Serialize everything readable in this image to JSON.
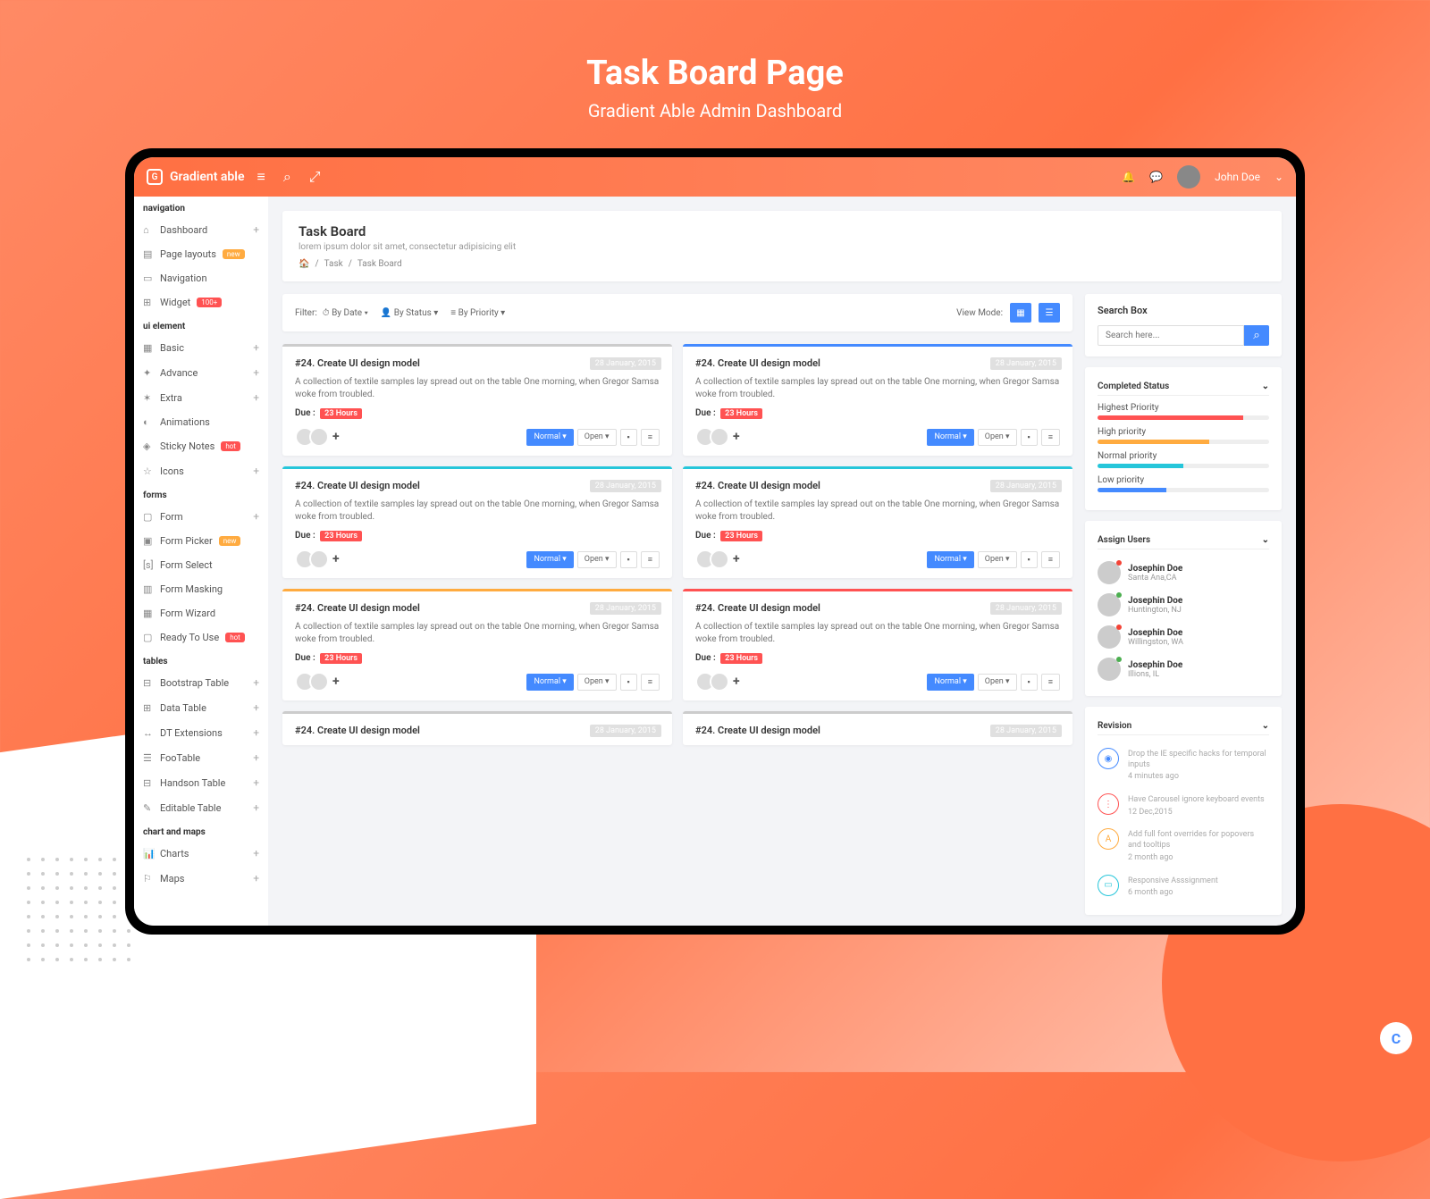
{
  "hero": {
    "title": "Task Board Page",
    "subtitle": "Gradient Able Admin Dashboard"
  },
  "brand": "Gradient able",
  "user": "John Doe",
  "page": {
    "title": "Task Board",
    "subtitle": "lorem ipsum dolor sit amet, consectetur adipisicing elit",
    "crumb1": "Task",
    "crumb2": "Task Board"
  },
  "nav": {
    "s1": "navigation",
    "dashboard": "Dashboard",
    "layouts": "Page layouts",
    "navitem": "Navigation",
    "widget": "Widget",
    "new": "new",
    "hundred": "100+",
    "s2": "ui element",
    "basic": "Basic",
    "advance": "Advance",
    "extra": "Extra",
    "anim": "Animations",
    "sticky": "Sticky Notes",
    "hot": "hot",
    "icons": "Icons",
    "s3": "forms",
    "form": "Form",
    "picker": "Form Picker",
    "select": "Form Select",
    "mask": "Form Masking",
    "wizard": "Form Wizard",
    "ready": "Ready To Use",
    "s4": "tables",
    "bstable": "Bootstrap Table",
    "dtable": "Data Table",
    "dtext": "DT Extensions",
    "foo": "FooTable",
    "handson": "Handson Table",
    "edit": "Editable Table",
    "s5": "chart and maps",
    "charts": "Charts",
    "maps": "Maps"
  },
  "filter": {
    "label": "Filter:",
    "date": "By Date",
    "status": "By Status",
    "priority": "By Priority",
    "viewmode": "View Mode:"
  },
  "task": {
    "title": "#24. Create UI design model",
    "date": "28 January, 2015",
    "desc": "A collection of textile samples lay spread out on the table One morning, when Gregor Samsa woke from troubled.",
    "due": "Due :",
    "duetime": "23 Hours",
    "normal": "Normal",
    "open": "Open"
  },
  "search": {
    "title": "Search Box",
    "placeholder": "Search here..."
  },
  "status": {
    "title": "Completed Status",
    "p1": "Highest Priority",
    "p2": "High priority",
    "p3": "Normal priority",
    "p4": "Low priority"
  },
  "users": {
    "title": "Assign Users",
    "name": "Josephin Doe",
    "l1": "Santa Ana,CA",
    "l2": "Huntington, NJ",
    "l3": "Willingston, WA",
    "l4": "Illions, IL"
  },
  "rev": {
    "title": "Revision",
    "r1": "Drop the IE specific hacks for temporal inputs",
    "t1": "4 minutes ago",
    "r2": "Have Carousel ignore keyboard events",
    "t2": "12 Dec,2015",
    "r3": "Add full font overrides for popovers and tooltips",
    "t3": "2 month ago",
    "r4": "Responsive Asssignment",
    "t4": "6 month ago"
  }
}
